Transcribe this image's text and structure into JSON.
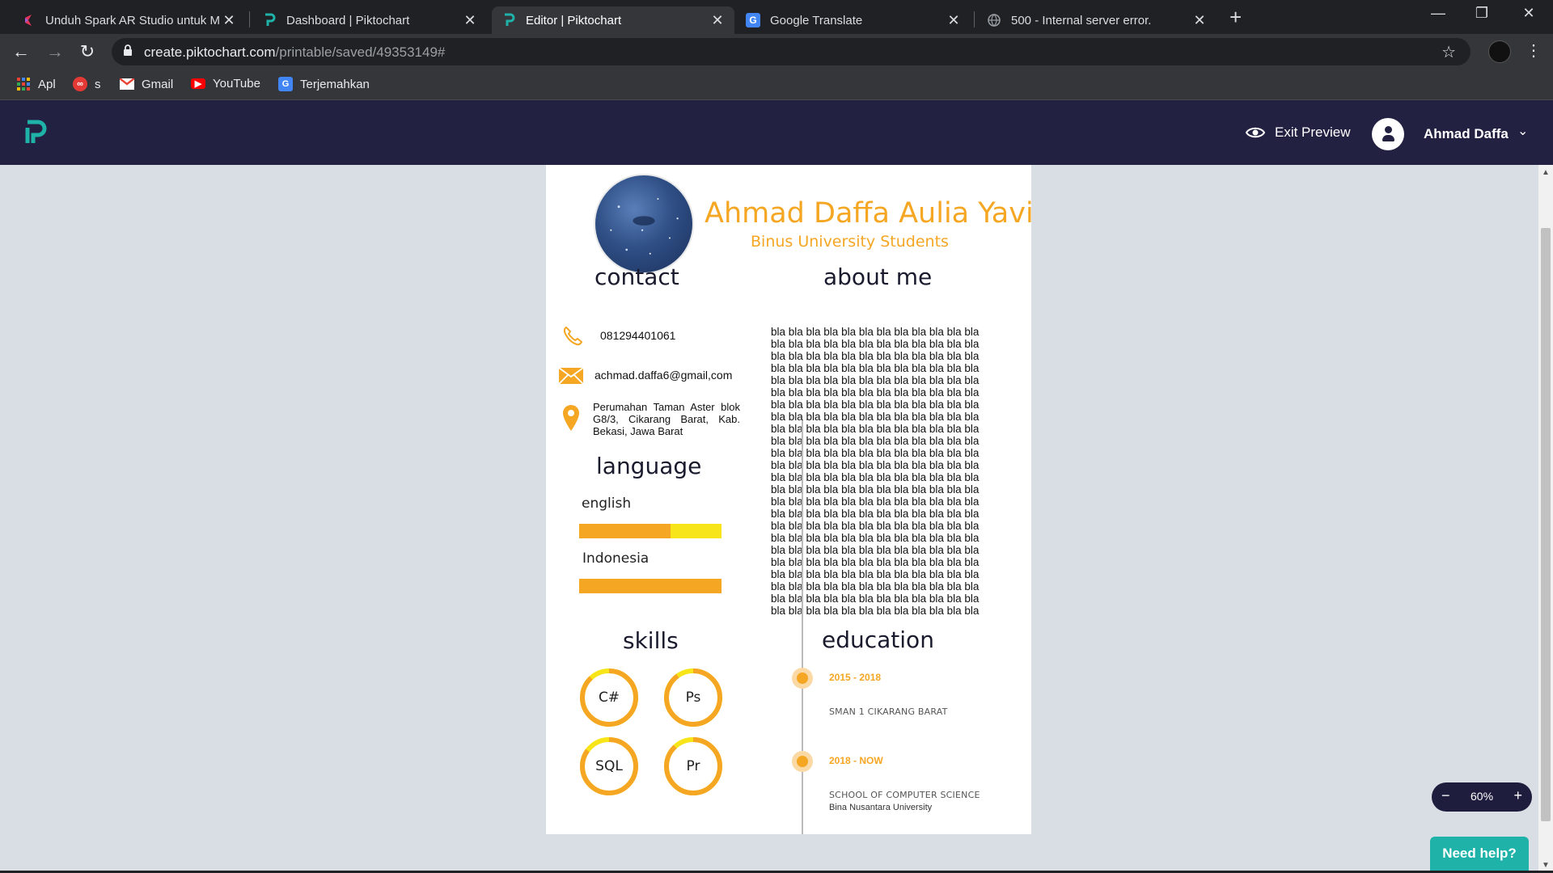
{
  "browser": {
    "tabs": [
      {
        "title": "Unduh Spark AR Studio untuk M",
        "favicon": "spark-ar-icon",
        "color": "#e8335a"
      },
      {
        "title": "Dashboard | Piktochart",
        "favicon": "piktochart-icon",
        "color": "#1fb2a8"
      },
      {
        "title": "Editor | Piktochart",
        "favicon": "piktochart-icon",
        "color": "#1fb2a8"
      },
      {
        "title": "Google Translate",
        "favicon": "google-translate-icon",
        "color": "#4285f4"
      },
      {
        "title": "500 - Internal server error.",
        "favicon": "globe-icon",
        "color": "#9aa0a6"
      }
    ],
    "active_tab": "Editor | Piktochart",
    "url_host": "create.piktochart.com",
    "url_path": "/printable/saved/49353149#",
    "bookmarks": [
      {
        "label": "Apl",
        "icon": "apps-grid-icon"
      },
      {
        "label": "s",
        "icon": "circle-logo-icon"
      },
      {
        "label": "Gmail",
        "icon": "gmail-icon"
      },
      {
        "label": "YouTube",
        "icon": "youtube-icon"
      },
      {
        "label": "Terjemahkan",
        "icon": "google-translate-icon"
      }
    ]
  },
  "app": {
    "exit_preview": "Exit Preview",
    "user_name": "Ahmad Daffa",
    "zoom": "60%",
    "help": "Need help?",
    "brand_color": "#222142",
    "accent": "#f5a623"
  },
  "resume": {
    "name": "Ahmad Daffa Aulia Yavi",
    "subtitle": "Binus University Students",
    "contact_heading": "contact",
    "phone": "081294401061",
    "email": "achmad.daffa6@gmail,com",
    "address": "Perumahan Taman Aster blok G8/3, Cikarang Barat, Kab. Bekasi, Jawa Barat",
    "language_heading": "language",
    "languages": [
      {
        "name": "english",
        "level": 0.64
      },
      {
        "name": "Indonesia",
        "level": 1.0
      }
    ],
    "about_heading": "about me",
    "about_line": "bla bla bla bla bla bla bla bla bla bla bla bla",
    "about_line_count": 24,
    "skills_heading": "skills",
    "skills": [
      {
        "name": "C#",
        "level": 0.88
      },
      {
        "name": "Ps",
        "level": 0.9
      },
      {
        "name": "SQL",
        "level": 0.85
      },
      {
        "name": "Pr",
        "level": 0.88
      }
    ],
    "education_heading": "education",
    "education": [
      {
        "years": "2015 - 2018",
        "school": "SMAN 1 CIKARANG BARAT",
        "detail": ""
      },
      {
        "years": "2018 - NOW",
        "school": "SCHOOL OF COMPUTER SCIENCE",
        "detail": "Bina Nusantara University"
      }
    ]
  }
}
